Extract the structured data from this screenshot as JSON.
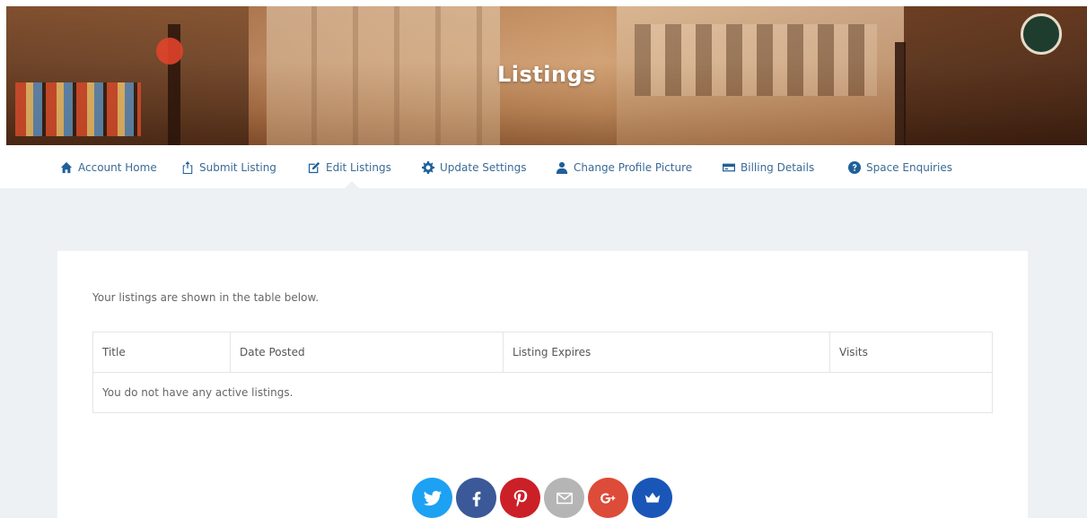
{
  "hero": {
    "title": "Listings"
  },
  "nav": {
    "items": [
      {
        "label": "Account Home",
        "icon": "home-icon"
      },
      {
        "label": "Submit Listing",
        "icon": "upload-icon"
      },
      {
        "label": "Edit Listings",
        "icon": "edit-icon"
      },
      {
        "label": "Update Settings",
        "icon": "gear-icon"
      },
      {
        "label": "Change Profile Picture",
        "icon": "user-icon"
      },
      {
        "label": "Billing Details",
        "icon": "credit-card-icon"
      },
      {
        "label": "Space Enquiries",
        "icon": "question-icon"
      }
    ],
    "active": "Edit Listings"
  },
  "main": {
    "intro": "Your listings are shown in the table below.",
    "table": {
      "headers": [
        "Title",
        "Date Posted",
        "Listing Expires",
        "Visits"
      ],
      "empty_message": "You do not have any active listings."
    }
  },
  "social": {
    "buttons": [
      {
        "name": "twitter",
        "icon": "twitter-icon",
        "color": "#1da1f2"
      },
      {
        "name": "facebook",
        "icon": "facebook-icon",
        "color": "#3b5998"
      },
      {
        "name": "pinterest",
        "icon": "pinterest-icon",
        "color": "#cb2027"
      },
      {
        "name": "email",
        "icon": "envelope-icon",
        "color": "#b5b5b5"
      },
      {
        "name": "google-plus",
        "icon": "google-plus-icon",
        "color": "#dd4b39"
      },
      {
        "name": "crown",
        "icon": "crown-icon",
        "color": "#1a56b8"
      }
    ]
  },
  "colors": {
    "accent": "#3a6a96",
    "icon": "#1f5f9a",
    "page_bg": "#eef1f4"
  }
}
